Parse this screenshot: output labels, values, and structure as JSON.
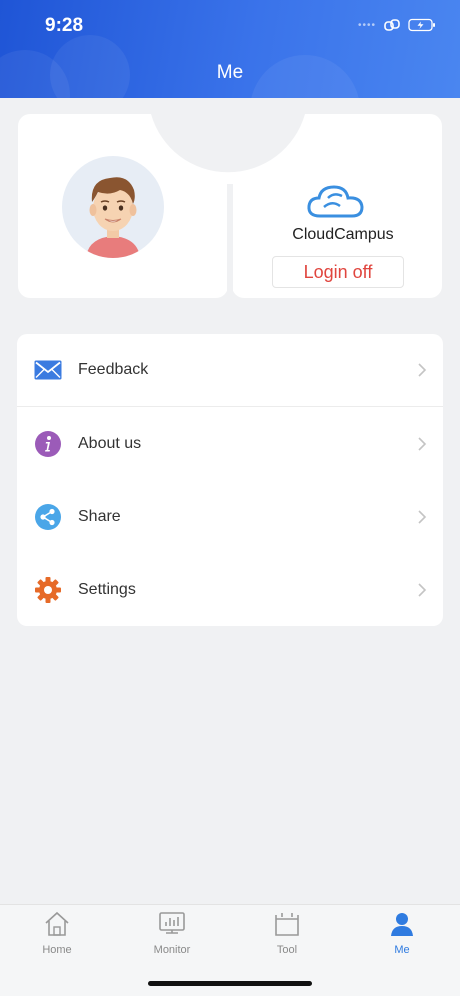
{
  "status_bar": {
    "time": "9:28",
    "signal_dots": "••••"
  },
  "header": {
    "title": "Me"
  },
  "profile": {
    "brand_name": "CloudCampus",
    "login_off_label": "Login off"
  },
  "menu": [
    {
      "label": "Feedback",
      "icon": "mail-icon",
      "color": "#3b7be0"
    },
    {
      "label": "About us",
      "icon": "info-icon",
      "color": "#9b5bb8"
    },
    {
      "label": "Share",
      "icon": "share-icon",
      "color": "#4aa6e8"
    },
    {
      "label": "Settings",
      "icon": "gear-icon",
      "color": "#e66a28"
    }
  ],
  "tabs": [
    {
      "label": "Home",
      "icon": "home-icon",
      "active": false
    },
    {
      "label": "Monitor",
      "icon": "monitor-icon",
      "active": false
    },
    {
      "label": "Tool",
      "icon": "tool-icon",
      "active": false
    },
    {
      "label": "Me",
      "icon": "person-icon",
      "active": true
    }
  ],
  "colors": {
    "header": "#2f66e0",
    "active_tab": "#2f7be0",
    "login_text": "#e0453e",
    "background": "#f0f1f3"
  }
}
